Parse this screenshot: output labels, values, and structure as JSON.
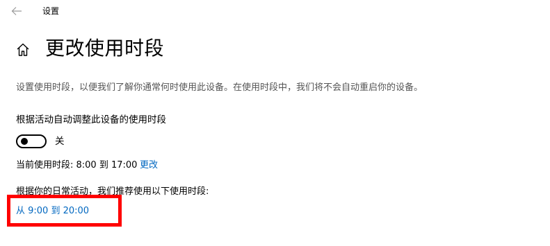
{
  "window": {
    "title": "设置"
  },
  "page": {
    "title": "更改使用时段",
    "description": "设置使用时段，以便我们了解你通常何时使用此设备。在使用时段中，我们将不会自动重启你的设备。"
  },
  "auto_adjust": {
    "label": "根据活动自动调整此设备的使用时段",
    "state": "关",
    "enabled": false
  },
  "current": {
    "text": "当前使用时段: 8:00 到 17:00",
    "change_label": "更改"
  },
  "recommendation": {
    "text": "根据你的日常活动，我们推荐使用以下使用时段:",
    "link": "从 9:00 到 20:00"
  },
  "colors": {
    "accent": "#0067c0",
    "highlight": "#ff0000"
  },
  "icons": {
    "back": "back-arrow-icon",
    "home": "home-icon"
  }
}
